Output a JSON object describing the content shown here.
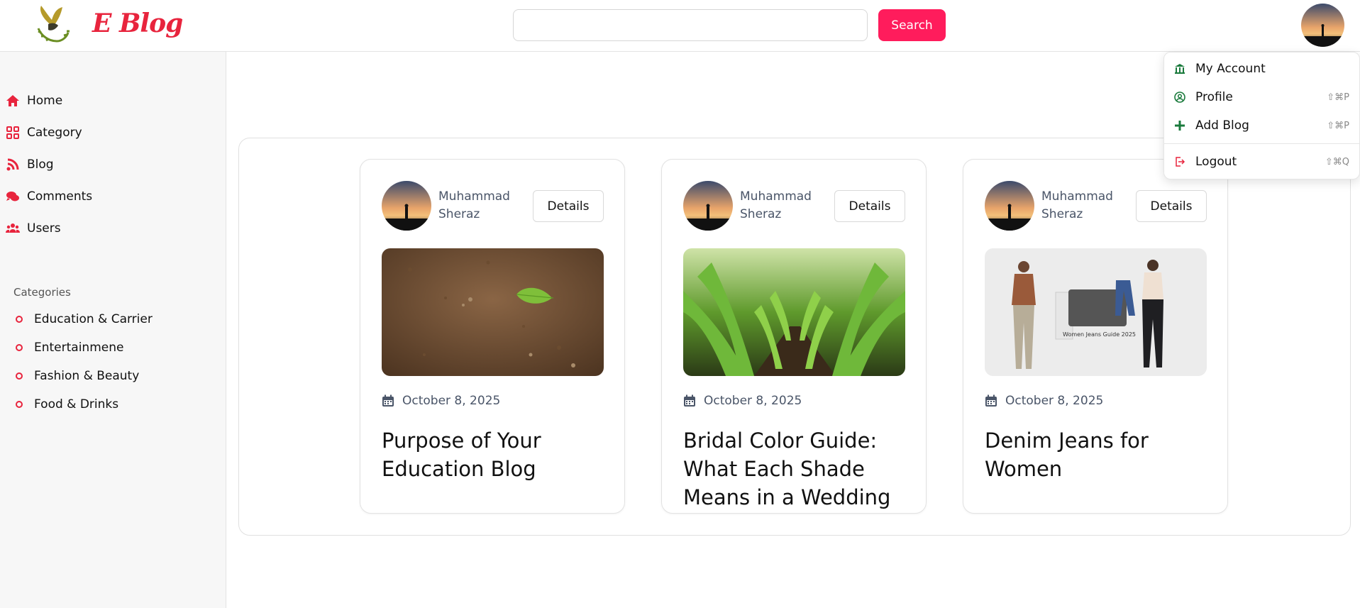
{
  "header": {
    "logo_text": "E Blog",
    "search_placeholder": "",
    "search_button": "Search"
  },
  "sidebar": {
    "nav": [
      {
        "label": "Home",
        "icon": "home-icon"
      },
      {
        "label": "Category",
        "icon": "grid-icon"
      },
      {
        "label": "Blog",
        "icon": "blog-icon"
      },
      {
        "label": "Comments",
        "icon": "comments-icon"
      },
      {
        "label": "Users",
        "icon": "users-icon"
      }
    ],
    "categories_heading": "Categories",
    "categories": [
      "Education & Carrier",
      "Entertainmene",
      "Fashion & Beauty",
      "Food & Drinks"
    ]
  },
  "cards": [
    {
      "author": "Muhammad Sheraz",
      "details": "Details",
      "date": "October 8, 2025",
      "title": "Purpose of Your Education Blog"
    },
    {
      "author": "Muhammad Sheraz",
      "details": "Details",
      "date": "October 8, 2025",
      "title": "Bridal Color Guide: What Each Shade Means in a Wedding"
    },
    {
      "author": "Muhammad Sheraz",
      "details": "Details",
      "date": "October 8, 2025",
      "title": "Denim Jeans for Women",
      "image_caption": "Women Jeans Guide 2025"
    }
  ],
  "dropdown": {
    "heading": "My Account",
    "items": [
      {
        "label": "Profile",
        "shortcut": "⇧⌘P"
      },
      {
        "label": "Add Blog",
        "shortcut": "⇧⌘P"
      },
      {
        "label": "Logout",
        "shortcut": "⇧⌘Q"
      }
    ]
  },
  "colors": {
    "accent": "#ff1c5c",
    "brand_red": "#e8243d",
    "dropdown_green": "#1a7a3c"
  }
}
